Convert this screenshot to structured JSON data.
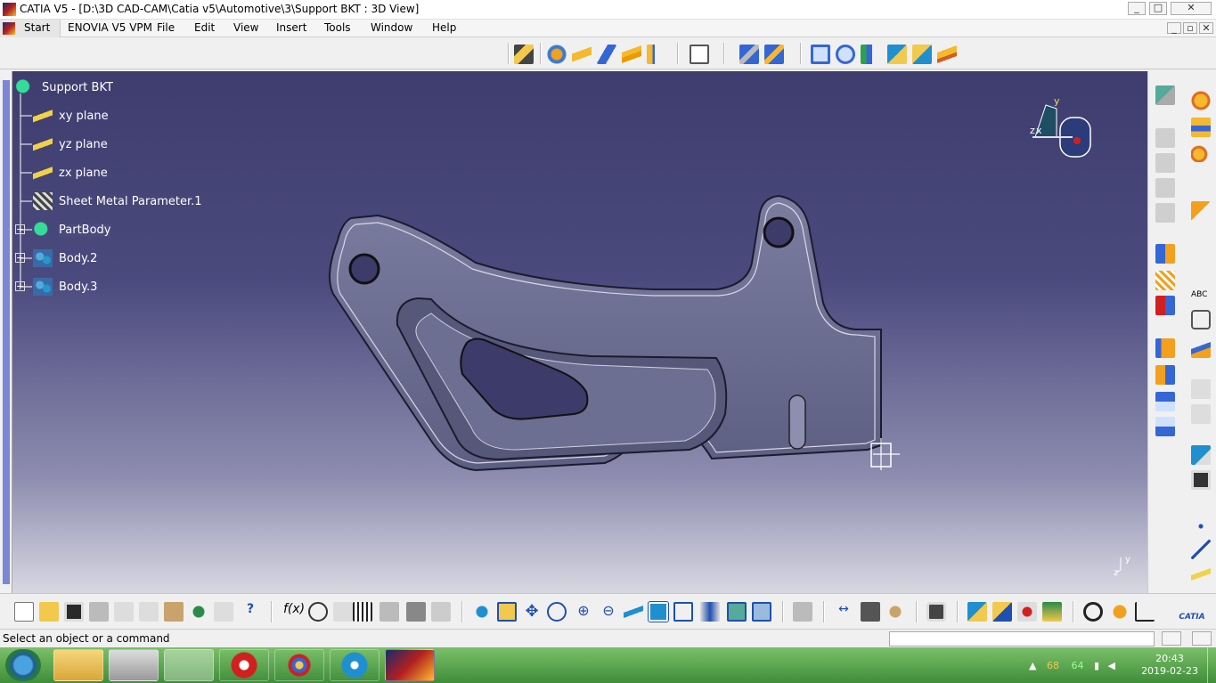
{
  "window": {
    "title": "CATIA V5 - [D:\\3D CAD-CAM\\Catia v5\\Automotive\\3\\Support BKT : 3D View]"
  },
  "menu": {
    "start": "Start",
    "items": [
      "ENOVIA V5 VPM",
      "File",
      "Edit",
      "View",
      "Insert",
      "Tools",
      "Window",
      "Help"
    ]
  },
  "tree": {
    "root": "Support BKT",
    "nodes": [
      {
        "label": "xy plane",
        "icon": "plane-icon"
      },
      {
        "label": "yz plane",
        "icon": "plane-icon"
      },
      {
        "label": "zx plane",
        "icon": "plane-icon"
      },
      {
        "label": "Sheet Metal Parameter.1",
        "icon": "sheet-metal-parameter-icon"
      },
      {
        "label": "PartBody",
        "icon": "partbody-icon"
      },
      {
        "label": "Body.2",
        "icon": "body-icon"
      },
      {
        "label": "Body.3",
        "icon": "body-icon"
      }
    ]
  },
  "compass": {
    "y": "y",
    "z": "z",
    "x": "x"
  },
  "axis_mini": {
    "z": "z",
    "y": "y"
  },
  "status": {
    "message": "Select an object or a command"
  },
  "taskbar": {
    "time": "20:43",
    "date": "2019-02-23",
    "tray_a": "68",
    "tray_b": "64",
    "apps": [
      "windows-start",
      "file-explorer",
      "calculator",
      "catia-tool",
      "opera",
      "paint",
      "snipping",
      "catia-v5"
    ]
  },
  "colors": {
    "viewport_top": "#3f3d6e",
    "viewport_bottom": "#d8d8e2",
    "tree_text": "#ffffff",
    "part": "#6e7191",
    "taskbar": "#4fa143"
  }
}
